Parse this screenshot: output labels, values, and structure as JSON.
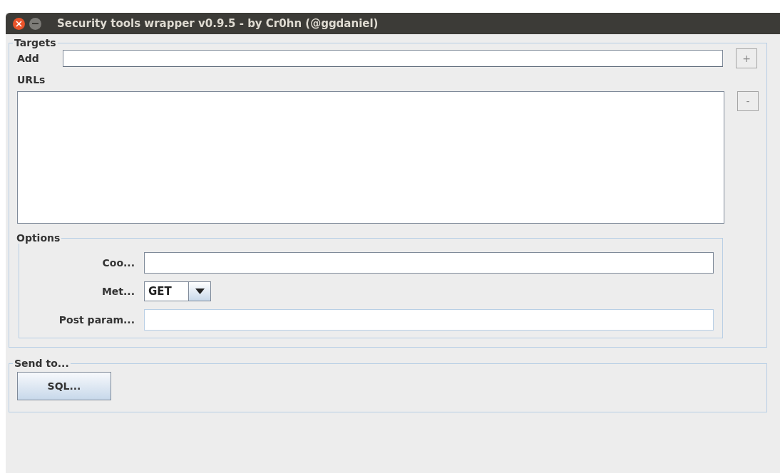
{
  "window": {
    "title": "Security tools wrapper v0.9.5 - by Cr0hn (@ggdaniel)"
  },
  "targets": {
    "title": "Targets",
    "add_label": "Add",
    "add_button": "+",
    "urls_label": "URLs",
    "remove_button": "-"
  },
  "options": {
    "title": "Options",
    "fields": [
      {
        "kind": "text",
        "label": "Coo...",
        "disabled": false
      },
      {
        "kind": "combo",
        "label": "Met...",
        "value": "GET"
      },
      {
        "kind": "text",
        "label": "Post param...",
        "disabled": true
      }
    ]
  },
  "send_to": {
    "title": "Send to...",
    "buttons": [
      "SQL..."
    ]
  }
}
